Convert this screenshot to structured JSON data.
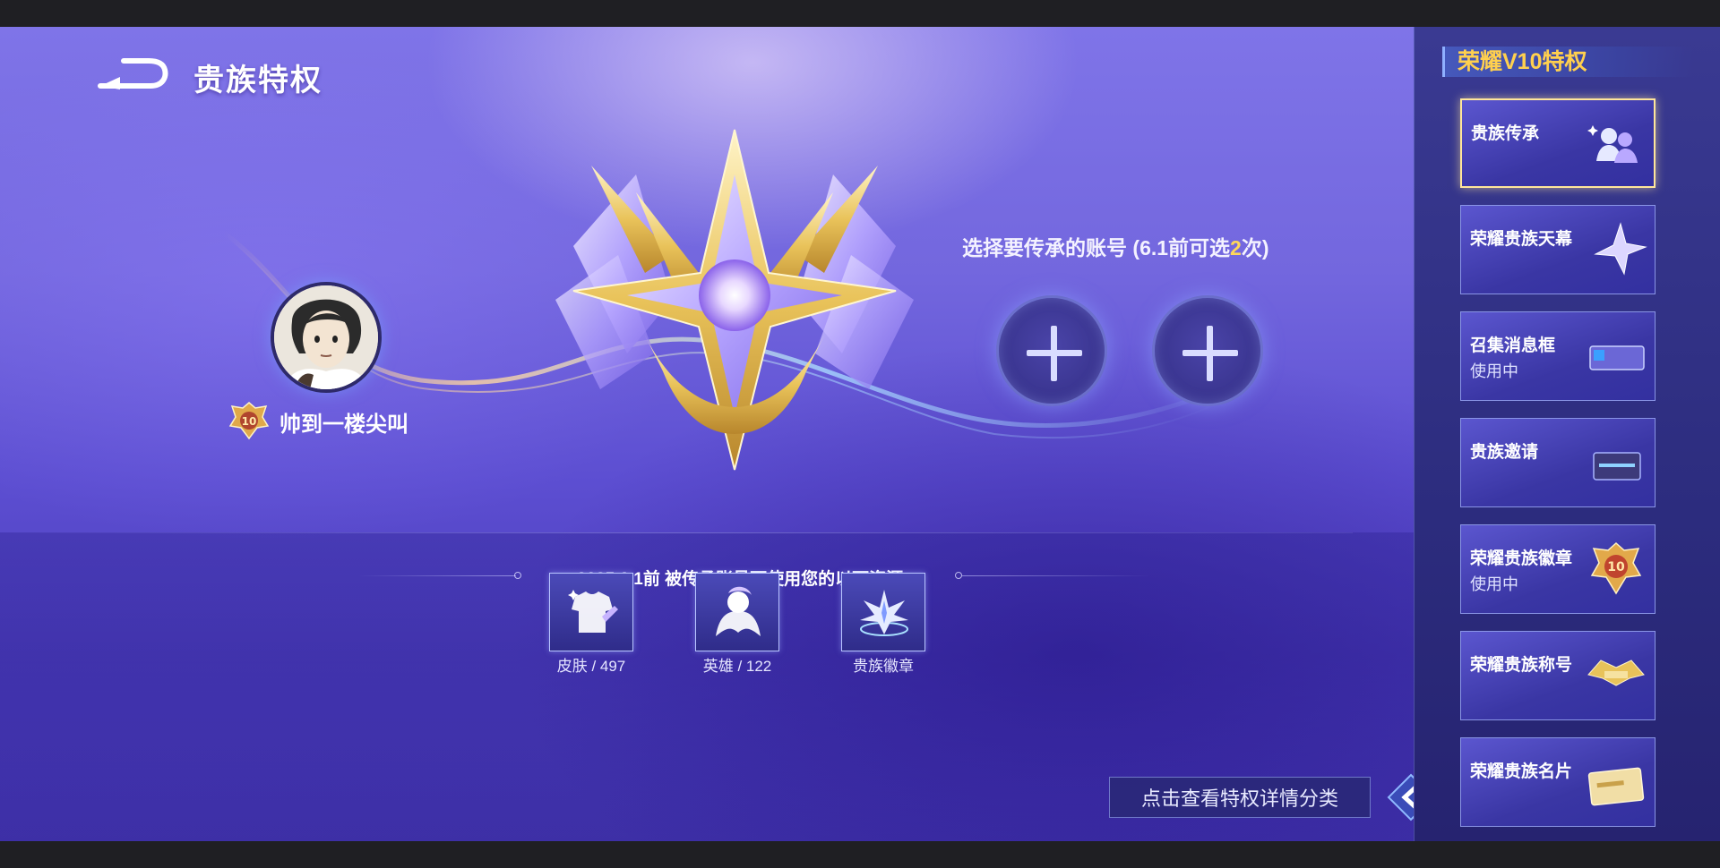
{
  "header": {
    "title": "贵族特权"
  },
  "player": {
    "name": "帅到一楼尖叫",
    "badge_level": "10"
  },
  "prompt": {
    "before": "选择要传承的账号 (",
    "date": "6.1",
    "mid": "前可选",
    "count": "2",
    "after": "次)"
  },
  "slots": [
    "add-account-slot-1",
    "add-account-slot-2"
  ],
  "resources": {
    "title": "2025.6.1前 被传承账号可使用您的以下资源",
    "items": [
      {
        "label": "皮肤 / 497",
        "icon": "skin-icon"
      },
      {
        "label": "英雄 / 122",
        "icon": "hero-icon"
      },
      {
        "label": "贵族徽章",
        "icon": "noble-badge-icon"
      }
    ]
  },
  "detail_button": {
    "label": "点击查看特权详情分类"
  },
  "sidebar": {
    "title": "荣耀V10特权",
    "items": [
      {
        "label": "贵族传承",
        "sub": "",
        "icon": "inheritance-people-icon",
        "active": true
      },
      {
        "label": "荣耀贵族天幕",
        "sub": "",
        "icon": "star-canopy-icon",
        "active": false
      },
      {
        "label": "召集消息框",
        "sub": "使用中",
        "icon": "message-frame-icon",
        "active": false
      },
      {
        "label": "贵族邀请",
        "sub": "",
        "icon": "invite-card-icon",
        "active": false
      },
      {
        "label": "荣耀贵族徽章",
        "sub": "使用中",
        "icon": "v10-badge-icon",
        "active": false
      },
      {
        "label": "荣耀贵族称号",
        "sub": "",
        "icon": "title-wings-icon",
        "active": false
      },
      {
        "label": "荣耀贵族名片",
        "sub": "",
        "icon": "name-card-icon",
        "active": false
      }
    ]
  },
  "colors": {
    "highlight": "#ffd75a",
    "side_title": "#ffd04e",
    "bg": "#6d61da"
  }
}
